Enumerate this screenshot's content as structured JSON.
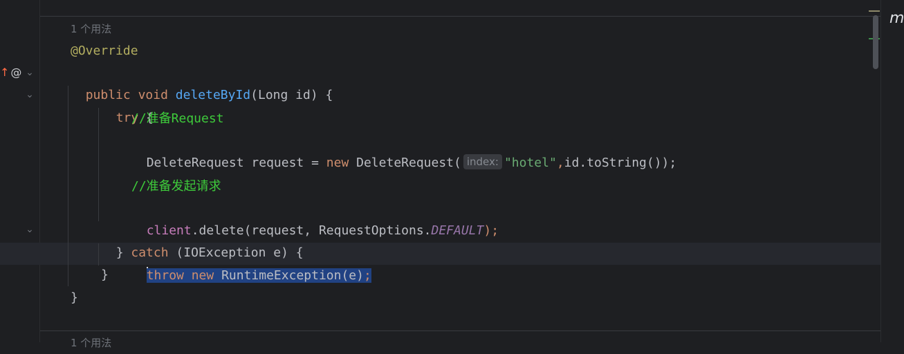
{
  "gutter": {
    "icons": [
      "override-arrow-icon",
      "annotation-at-icon"
    ],
    "at_symbol": "@",
    "up_arrow": "↑"
  },
  "code": {
    "usage_hint_1": "1 个用法",
    "annotation": "@Override",
    "l_public": "public",
    "l_void": "void",
    "l_method": "deleteById",
    "l_params": "(Long id) {",
    "l_try": "try",
    "l_try_brace": " {",
    "comment_1": "//准备Request",
    "l_decl_type": "DeleteRequest request = ",
    "l_new": "new",
    "l_ctor": " DeleteRequest(",
    "param_hint": "index:",
    "l_str": "\"hotel\"",
    "l_comma": ",",
    "l_tostring": "id.toString());",
    "comment_2": "//准备发起请求",
    "l_client": "client",
    "l_delete": ".delete(request, RequestOptions.",
    "l_default": "DEFAULT",
    "l_close": ");",
    "l_catch_open": "} ",
    "l_catch": "catch",
    "l_catch_rest": " (IOException e) {",
    "l_throw": "throw",
    "l_space": " ",
    "l_new2": "new",
    "l_runtime": " RuntimeException(e)",
    "l_semicolon": ";",
    "l_close_brace": "}",
    "l_close_brace2": "}",
    "usage_hint_2": "1 个用法"
  },
  "right_panel": {
    "letter": "m"
  },
  "colors": {
    "background": "#1e1f22",
    "keyword": "#cf8e6d",
    "annotation": "#b3ae60",
    "method": "#56a8f5",
    "string": "#6aab73",
    "comment": "#3ecb3b",
    "field": "#c77dbb",
    "constant": "#9876aa",
    "selection": "#214283"
  }
}
